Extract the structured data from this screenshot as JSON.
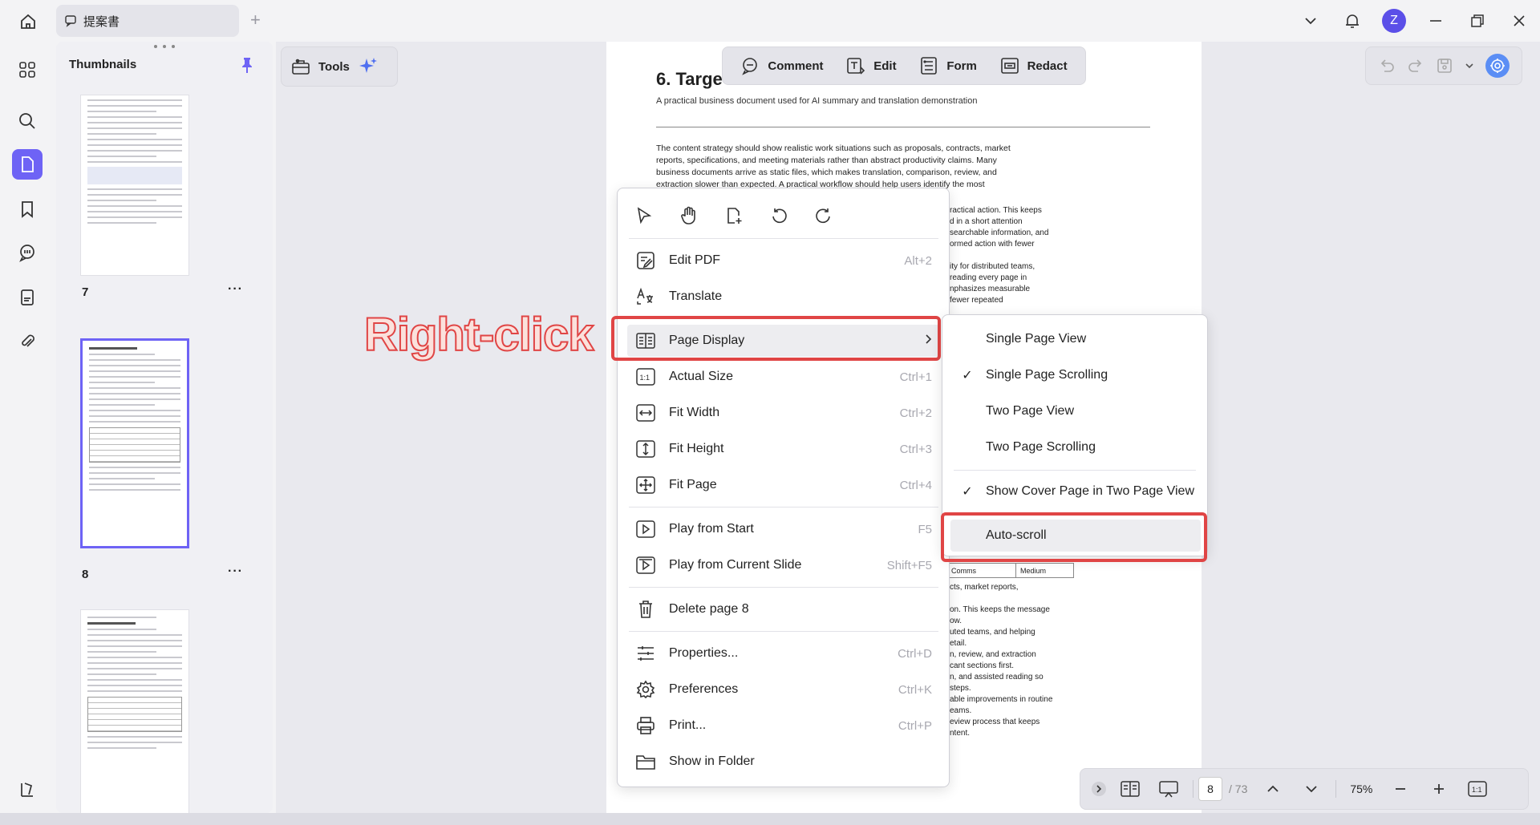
{
  "topbar": {
    "tab_title": "提案書",
    "add_tab": "+",
    "avatar_letter": "Z"
  },
  "thumbnails": {
    "title": "Thumbnails",
    "pages": [
      {
        "number": "7",
        "more": "···"
      },
      {
        "number": "8",
        "more": "···"
      }
    ]
  },
  "tools": {
    "label": "Tools"
  },
  "center_toolbar": {
    "comment": "Comment",
    "edit": "Edit",
    "form": "Form",
    "redact": "Redact"
  },
  "document": {
    "heading": "6. Targe",
    "subtitle": "A practical business document used for AI summary and translation demonstration",
    "para1": [
      "The content strategy should show realistic work situations such as proposals, contracts, market",
      "reports, specifications, and meeting materials rather than abstract productivity claims. Many",
      "business documents arrive as static files, which makes translation, comparison, review, and",
      "extraction slower than expected. A practical workflow should help users identify the most"
    ],
    "frag_right": [
      "ractical action. This keeps",
      "d in a short attention",
      "searchable information, and",
      "ormed action with fewer",
      "",
      "ity for distributed teams,",
      "reading every page in",
      "nphasizes measurable",
      "fewer repeated"
    ],
    "table_row": [
      "Comms",
      "Medium"
    ],
    "frag_lower": [
      "cts, market reports,",
      "",
      "on. This keeps the message",
      "ow.",
      "uted teams, and helping",
      "etail.",
      "n, review, and extraction",
      "cant sections first.",
      "n, and assisted reading so",
      "steps.",
      "able improvements in routine",
      "eams.",
      "eview process that keeps",
      "ntent."
    ]
  },
  "annotation": "Right-click",
  "context_menu": {
    "items": [
      {
        "label": "Edit PDF",
        "shortcut": "Alt+2"
      },
      {
        "label": "Translate",
        "shortcut": ""
      },
      {
        "label": "Page Display",
        "shortcut": ""
      },
      {
        "label": "Actual Size",
        "shortcut": "Ctrl+1"
      },
      {
        "label": "Fit Width",
        "shortcut": "Ctrl+2"
      },
      {
        "label": "Fit Height",
        "shortcut": "Ctrl+3"
      },
      {
        "label": "Fit Page",
        "shortcut": "Ctrl+4"
      },
      {
        "label": "Play from Start",
        "shortcut": "F5"
      },
      {
        "label": "Play from Current Slide",
        "shortcut": "Shift+F5"
      },
      {
        "label": "Delete page 8",
        "shortcut": ""
      },
      {
        "label": "Properties...",
        "shortcut": "Ctrl+D"
      },
      {
        "label": "Preferences",
        "shortcut": "Ctrl+K"
      },
      {
        "label": "Print...",
        "shortcut": "Ctrl+P"
      },
      {
        "label": "Show in Folder",
        "shortcut": ""
      }
    ]
  },
  "submenu": {
    "items": [
      {
        "label": "Single Page View",
        "checked": ""
      },
      {
        "label": "Single Page Scrolling",
        "checked": "✓"
      },
      {
        "label": "Two Page View",
        "checked": ""
      },
      {
        "label": "Two Page Scrolling",
        "checked": ""
      },
      {
        "label": "Show Cover Page in Two Page View",
        "checked": "✓"
      },
      {
        "label": "Auto-scroll",
        "checked": ""
      }
    ]
  },
  "bottom_bar": {
    "current_page": "8",
    "total_pages": "/ 73",
    "zoom": "75%"
  },
  "colors": {
    "accent": "#6e63f5",
    "highlight_red": "#e04545"
  }
}
